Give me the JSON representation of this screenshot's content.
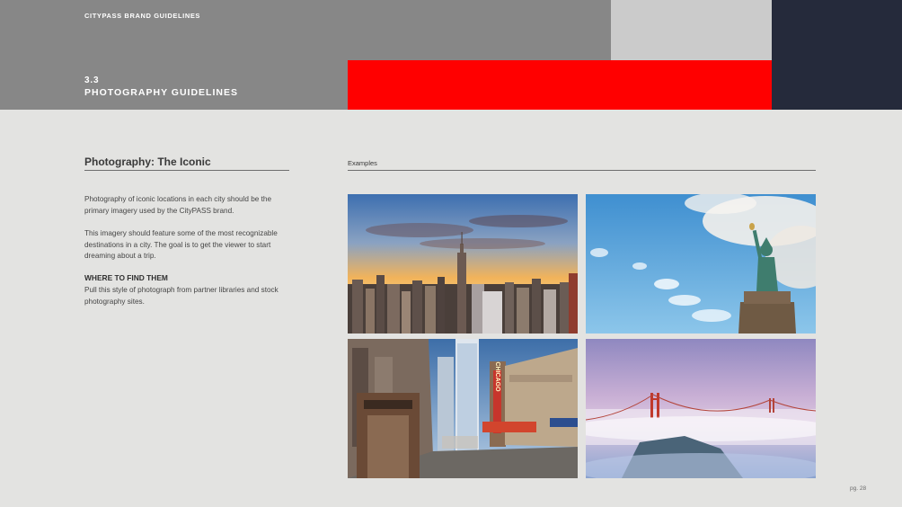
{
  "header": {
    "brand": "CITYPASS BRAND GUIDELINES",
    "section_number": "3.3",
    "section_title": "PHOTOGRAPHY GUIDELINES",
    "colors": {
      "gray": "#878787",
      "light_gray": "#cbcbcb",
      "red": "#ff0000",
      "navy": "#252a3b"
    }
  },
  "left": {
    "title": "Photography: The Iconic",
    "paragraph1": "Photography of iconic locations in each city should be the primary imagery used by the CityPASS brand.",
    "paragraph2": "This imagery should feature some of the most recognizable destinations in a city. The goal is to get the viewer to start dreaming about a trip.",
    "where_heading": "WHERE TO FIND THEM",
    "paragraph3": "Pull this style of photograph from partner libraries and stock photography sites."
  },
  "examples": {
    "label": "Examples",
    "photos": [
      {
        "icon": "new-york-skyline-photo"
      },
      {
        "icon": "statue-of-liberty-photo"
      },
      {
        "icon": "chicago-theatre-street-photo",
        "sign_text": "CHICAGO"
      },
      {
        "icon": "golden-gate-bridge-fog-photo"
      }
    ]
  },
  "footer": {
    "page": "pg. 28"
  }
}
